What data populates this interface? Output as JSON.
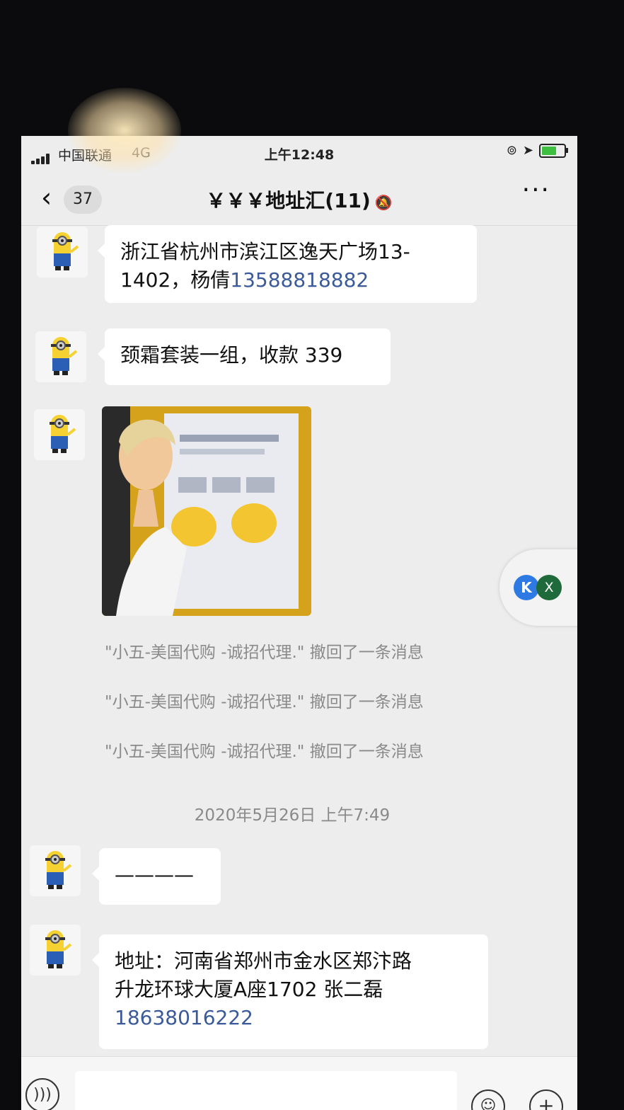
{
  "status_bar": {
    "carrier": "中国联通",
    "network": "4G",
    "time": "上午12:48",
    "icons": [
      "lock-rotation-icon",
      "location-arrow-icon",
      "battery-charging-icon"
    ]
  },
  "header": {
    "back_count": "37",
    "title": "￥￥￥地址汇(11)",
    "mute_icon": "mute-bell-icon",
    "more_icon": "more-dots-icon"
  },
  "messages": [
    {
      "type": "text",
      "parts": [
        "浙江省杭州市滨江区逸天广场13-",
        "1402，杨倩"
      ],
      "phone": "13588818882"
    },
    {
      "type": "text",
      "text": "颈霜套装一组，收款 339"
    },
    {
      "type": "image",
      "description_icon": "product-photo"
    },
    {
      "type": "recall",
      "text": "\"小五-美国代购 -诚招代理.\" 撤回了一条消息"
    },
    {
      "type": "recall",
      "text": "\"小五-美国代购 -诚招代理.\" 撤回了一条消息"
    },
    {
      "type": "recall",
      "text": "\"小五-美国代购 -诚招代理.\" 撤回了一条消息"
    },
    {
      "type": "timestamp",
      "text": "2020年5月26日 上午7:49"
    },
    {
      "type": "text",
      "text": "————"
    },
    {
      "type": "text",
      "parts": [
        "地址：河南省郑州市金水区郑汴路",
        "升龙环球大厦A座1702 张二磊"
      ],
      "phone": "18638016222"
    }
  ],
  "floating_widget": {
    "left_label": "K",
    "right_label": "X"
  },
  "input_bar": {
    "voice_icon": "voice-icon",
    "emoji_icon": "emoji-icon",
    "plus_icon": "plus-icon"
  },
  "colors": {
    "background": "#ededed",
    "bubble": "#ffffff",
    "link": "#3b5a9a",
    "system_text": "#8a8a8a"
  }
}
